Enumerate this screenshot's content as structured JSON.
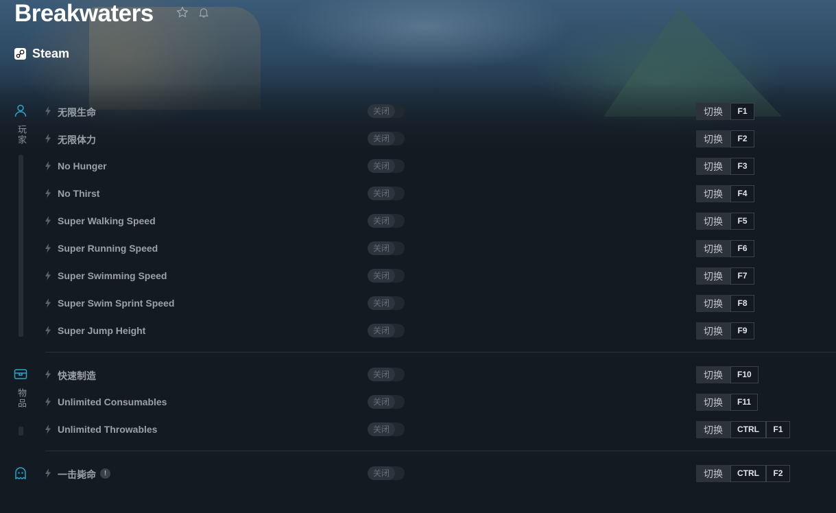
{
  "game": {
    "title": "Breakwaters",
    "platform": "Steam"
  },
  "icons": {
    "favorite": "star-icon",
    "notify": "bell-icon",
    "platform": "steam-icon",
    "option": "bolt-icon"
  },
  "colors": {
    "accent": "#2aa7c9",
    "background": "#141a21"
  },
  "categories": [
    {
      "label": "玩家",
      "icon": "player-icon"
    },
    {
      "label": "物品",
      "icon": "chest-icon"
    },
    {
      "label": "",
      "icon": "ghost-icon"
    }
  ],
  "options": [
    {
      "name": "无限生命",
      "state": "关闭",
      "action": "切换",
      "keys": [
        "F1"
      ]
    },
    {
      "name": "无限体力",
      "state": "关闭",
      "action": "切换",
      "keys": [
        "F2"
      ]
    },
    {
      "name": "No Hunger",
      "state": "关闭",
      "action": "切换",
      "keys": [
        "F3"
      ]
    },
    {
      "name": "No Thirst",
      "state": "关闭",
      "action": "切换",
      "keys": [
        "F4"
      ]
    },
    {
      "name": "Super Walking Speed",
      "state": "关闭",
      "action": "切换",
      "keys": [
        "F5"
      ]
    },
    {
      "name": "Super Running Speed",
      "state": "关闭",
      "action": "切换",
      "keys": [
        "F6"
      ]
    },
    {
      "name": "Super Swimming Speed",
      "state": "关闭",
      "action": "切换",
      "keys": [
        "F7"
      ]
    },
    {
      "name": "Super Swim Sprint Speed",
      "state": "关闭",
      "action": "切换",
      "keys": [
        "F8"
      ]
    },
    {
      "name": "Super Jump Height",
      "state": "关闭",
      "action": "切换",
      "keys": [
        "F9"
      ]
    },
    {
      "name": "快速制造",
      "state": "关闭",
      "action": "切换",
      "keys": [
        "F10"
      ]
    },
    {
      "name": "Unlimited Consumables",
      "state": "关闭",
      "action": "切换",
      "keys": [
        "F11"
      ]
    },
    {
      "name": "Unlimited Throwables",
      "state": "关闭",
      "action": "切换",
      "keys": [
        "CTRL",
        "F1"
      ]
    },
    {
      "name": "一击毙命",
      "state": "关闭",
      "action": "切换",
      "keys": [
        "CTRL",
        "F2"
      ],
      "info": "!"
    }
  ]
}
